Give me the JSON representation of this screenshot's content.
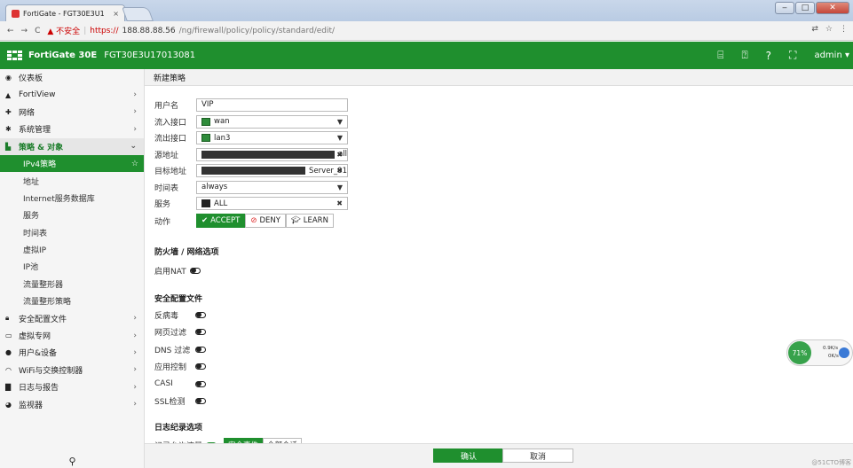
{
  "browser": {
    "tab_title": "FortiGate - FGT30E3U1",
    "tab_close": "×",
    "url_warning": "▲ 不安全",
    "url_scheme": "https://",
    "url_host": "188.88.88.56",
    "url_path": "/ng/firewall/policy/policy/standard/edit/"
  },
  "header": {
    "product": "FortiGate 30E",
    "serial": "FGT30E3U17013081",
    "user": "admin"
  },
  "sidebar": {
    "items": [
      {
        "label": "仪表板",
        "icon": "dashboard-icon",
        "chevron": ""
      },
      {
        "label": "FortiView",
        "icon": "chart-icon",
        "chevron": "›"
      },
      {
        "label": "网络",
        "icon": "network-icon",
        "chevron": "›"
      },
      {
        "label": "系统管理",
        "icon": "gear-icon",
        "chevron": "›"
      },
      {
        "label": "策略 & 对象",
        "icon": "policy-icon",
        "chevron": "⌄"
      },
      {
        "label": "IPv4策略",
        "icon": "",
        "chevron": ""
      },
      {
        "label": "地址",
        "icon": "",
        "chevron": ""
      },
      {
        "label": "Internet服务数据库",
        "icon": "",
        "chevron": ""
      },
      {
        "label": "服务",
        "icon": "",
        "chevron": ""
      },
      {
        "label": "时间表",
        "icon": "",
        "chevron": ""
      },
      {
        "label": "虚拟IP",
        "icon": "",
        "chevron": ""
      },
      {
        "label": "IP池",
        "icon": "",
        "chevron": ""
      },
      {
        "label": "流量整形器",
        "icon": "",
        "chevron": ""
      },
      {
        "label": "流量整形策略",
        "icon": "",
        "chevron": ""
      },
      {
        "label": "安全配置文件",
        "icon": "lock-icon",
        "chevron": "›"
      },
      {
        "label": "虚拟专网",
        "icon": "monitor-icon",
        "chevron": "›"
      },
      {
        "label": "用户&设备",
        "icon": "user-icon",
        "chevron": "›"
      },
      {
        "label": "WiFi与交换控制器",
        "icon": "wifi-icon",
        "chevron": "›"
      },
      {
        "label": "日志与报告",
        "icon": "bar-chart-icon",
        "chevron": "›"
      },
      {
        "label": "监视器",
        "icon": "pie-chart-icon",
        "chevron": "›"
      }
    ]
  },
  "main": {
    "title": "新建策略",
    "fields": {
      "name_label": "用户名",
      "name_value": "VIP",
      "in_label": "流入接口",
      "in_value": "wan",
      "out_label": "流出接口",
      "out_value": "lan3",
      "src_label": "源地址",
      "src_value": "all",
      "dst_label": "目标地址",
      "dst_value": "Server_01",
      "sched_label": "时间表",
      "sched_value": "always",
      "svc_label": "服务",
      "svc_value": "ALL",
      "action_label": "动作"
    },
    "actions": {
      "accept": "ACCEPT",
      "deny": "DENY",
      "learn": "LEARN"
    },
    "firewall_section": "防火墙 / 网络选项",
    "nat_label": "启用NAT",
    "security_section": "安全配置文件",
    "security_items": [
      "反病毒",
      "网页过滤",
      "DNS 过滤",
      "应用控制",
      "CASI",
      "SSL检测"
    ],
    "log_section": "日志纪录选项",
    "log_label": "记录允许流量",
    "log_options": [
      "安全事件",
      "全部会话"
    ]
  },
  "footer": {
    "ok": "确认",
    "cancel": "取消",
    "watermark": "@51CTO博客"
  },
  "netwidget": {
    "percent": "71%",
    "up": "0.9K/s",
    "down": "0K/s"
  },
  "colors": {
    "brand_green": "#1f8f2e"
  }
}
